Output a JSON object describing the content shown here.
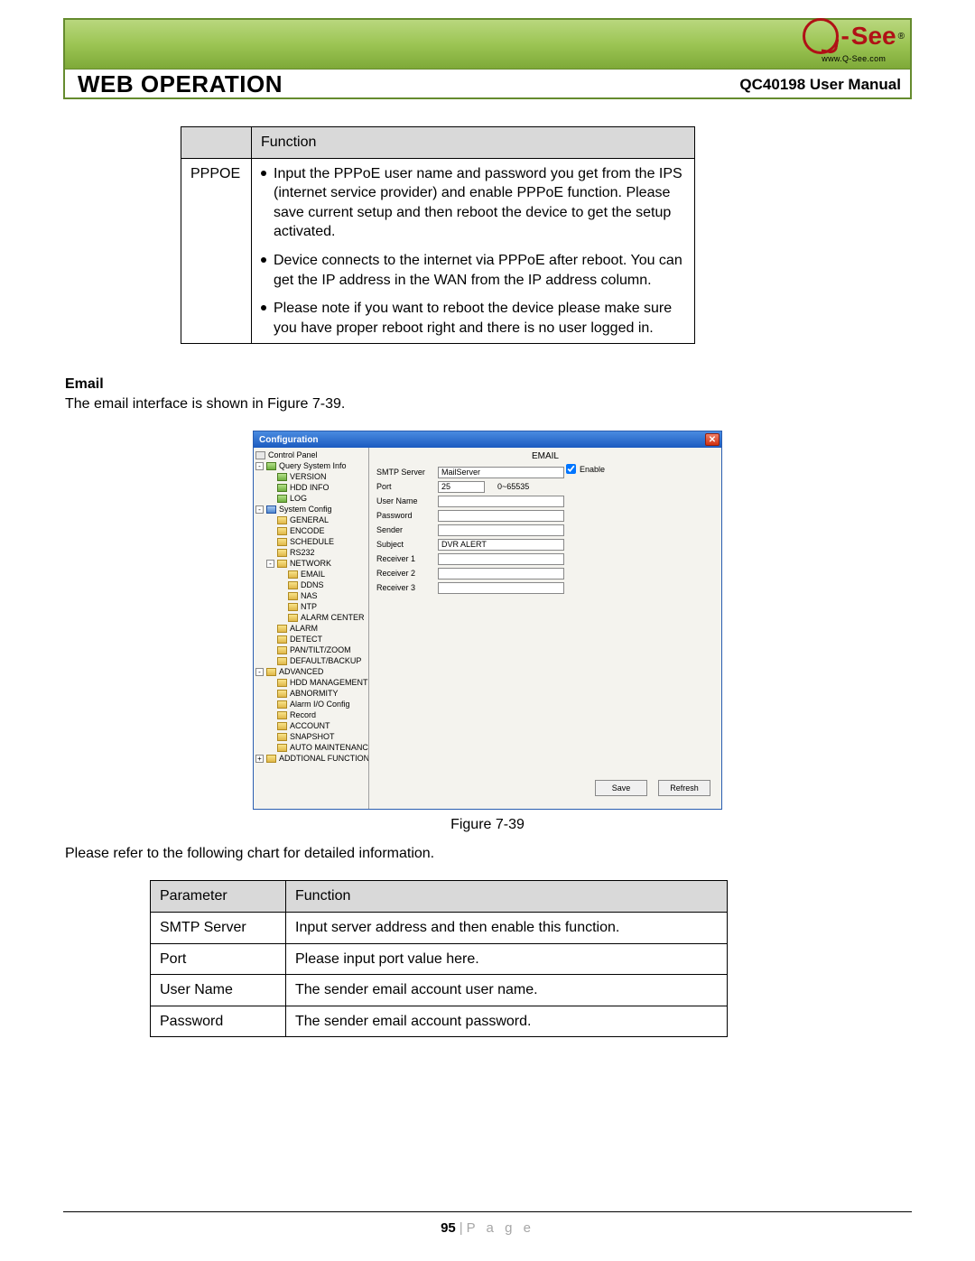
{
  "header": {
    "title": "WEB OPERATION",
    "subtitle": "QC40198 User Manual",
    "logo_brand": "See",
    "logo_url": "www.Q-See.com"
  },
  "table1": {
    "col1_header": "",
    "col2_header": "Function",
    "row_label": "PPPOE",
    "bullets": [
      "Input the PPPoE user name and password you get from the IPS (internet service provider) and enable PPPoE function. Please save current setup and then reboot the device to get the setup activated.",
      "Device connects to the internet via PPPoE after reboot. You can get the IP address in the WAN from the IP address column.",
      "Please note if you want to reboot the device please make sure you have proper reboot right and there is no user logged in."
    ]
  },
  "email_section": {
    "heading": "Email",
    "intro": "The email interface is shown in Figure 7-39."
  },
  "dialog": {
    "title": "Configuration",
    "panel_title": "EMAIL",
    "enable_label": "Enable",
    "form": {
      "smtp_label": "SMTP Server",
      "smtp_value": "MailServer",
      "port_label": "Port",
      "port_value": "25",
      "port_hint": "0~65535",
      "user_label": "User Name",
      "user_value": "",
      "pass_label": "Password",
      "pass_value": "",
      "sender_label": "Sender",
      "sender_value": "",
      "subject_label": "Subject",
      "subject_value": "DVR ALERT",
      "r1_label": "Receiver 1",
      "r2_label": "Receiver 2",
      "r3_label": "Receiver 3"
    },
    "save_button": "Save",
    "refresh_button": "Refresh",
    "tree": {
      "control_panel": "Control Panel",
      "query": "Query System Info",
      "version": "VERSION",
      "hdd_info": "HDD INFO",
      "log": "LOG",
      "sysconf": "System Config",
      "general": "GENERAL",
      "encode": "ENCODE",
      "schedule": "SCHEDULE",
      "rs232": "RS232",
      "network": "NETWORK",
      "email": "EMAIL",
      "ddns": "DDNS",
      "nas": "NAS",
      "ntp": "NTP",
      "alarm_center": "ALARM CENTER",
      "alarm": "ALARM",
      "detect": "DETECT",
      "ptz": "PAN/TILT/ZOOM",
      "default_backup": "DEFAULT/BACKUP",
      "advanced": "ADVANCED",
      "hdd_mgmt": "HDD MANAGEMENT",
      "abnormity": "ABNORMITY",
      "alarm_io": "Alarm I/O Config",
      "record": "Record",
      "account": "ACCOUNT",
      "snapshot": "SNAPSHOT",
      "auto_maint": "AUTO MAINTENANCE",
      "additional": "ADDTIONAL FUNCTION"
    }
  },
  "figure_caption": "Figure 7-39",
  "chart_intro": "Please refer to the following chart for detailed information.",
  "table2": {
    "h1": "Parameter",
    "h2": "Function",
    "rows": [
      {
        "p": "SMTP Server",
        "f": "Input server address and then enable this function."
      },
      {
        "p": "Port",
        "f": "Please input port value here."
      },
      {
        "p": "User Name",
        "f": "The sender email account user name."
      },
      {
        "p": "Password",
        "f": "The sender email account password."
      }
    ]
  },
  "footer": {
    "page_number": "95",
    "page_word": "P a g e"
  }
}
